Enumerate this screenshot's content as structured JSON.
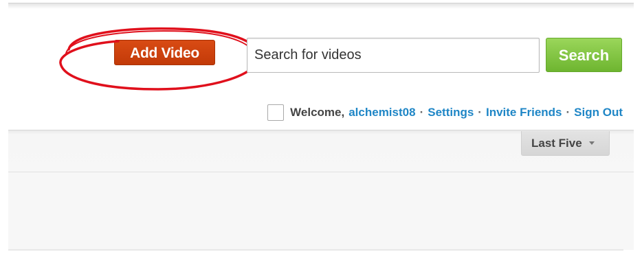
{
  "header": {
    "add_video_label": "Add Video",
    "search": {
      "placeholder": "Search for videos",
      "value": "",
      "button_label": "Search"
    }
  },
  "user_bar": {
    "welcome": "Welcome,",
    "username": "alchemist08",
    "separator": "·",
    "links": {
      "settings": "Settings",
      "invite_friends": "Invite Friends",
      "sign_out": "Sign Out"
    }
  },
  "toolbar": {
    "filter_selected": "Last Five"
  },
  "annotation": {
    "color": "#e0101c"
  },
  "colors": {
    "add_video": "#c9400b",
    "search_button": "#7cc23f",
    "link": "#1f86c6"
  }
}
